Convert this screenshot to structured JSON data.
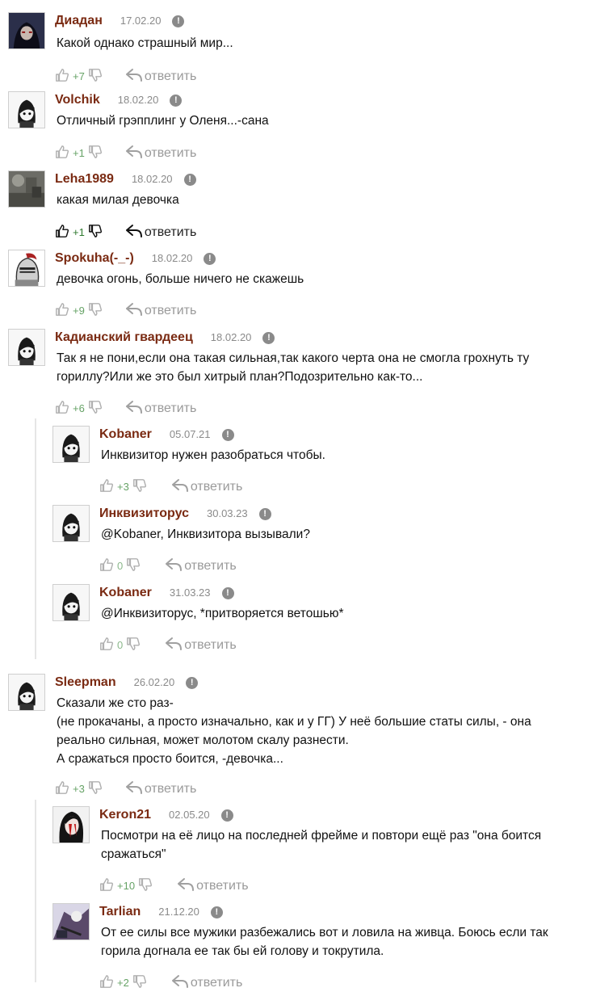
{
  "reply_label": "ответить",
  "comments": [
    {
      "author": "Диадан",
      "date": "17.02.20",
      "text": [
        "Какой однако страшный мир..."
      ],
      "votes": "+7"
    },
    {
      "author": "Volchik",
      "date": "18.02.20",
      "text": [
        "Отличный грэпплинг у Оленя...-сана"
      ],
      "votes": "+1"
    },
    {
      "author": "Leha1989",
      "date": "18.02.20",
      "text": [
        "какая милая девочка"
      ],
      "votes": "+1"
    },
    {
      "author": "Spokuha(-_-)",
      "date": "18.02.20",
      "text": [
        "девочка огонь, больше ничего не скажешь"
      ],
      "votes": "+9"
    },
    {
      "author": "Кадианский гвардеец",
      "date": "18.02.20",
      "text": [
        "Так я не пони,если она такая сильная,так какого черта она не смогла грохнуть ту",
        "гориллу?Или же это был хитрый план?Подозрительно как-то..."
      ],
      "votes": "+6"
    },
    {
      "author": "Kobaner",
      "date": "05.07.21",
      "text": [
        "Инквизитор нужен разобраться чтобы."
      ],
      "votes": "+3"
    },
    {
      "author": "Инквизиторус",
      "date": "30.03.23",
      "text": [
        "@Kobaner, Инквизитора вызывали?"
      ],
      "votes": "0"
    },
    {
      "author": "Kobaner",
      "date": "31.03.23",
      "text": [
        "@Инквизиторус, *притворяется ветошью*"
      ],
      "votes": "0"
    },
    {
      "author": "Sleepman",
      "date": "26.02.20",
      "text": [
        "Сказали же сто раз-",
        "(не прокачаны, а просто изначально, как и у ГГ) У неё большие статы силы, - она",
        "реально сильная, может молотом скалу разнести.",
        "А сражаться просто боится, -девочка..."
      ],
      "votes": "+3"
    },
    {
      "author": "Keron21",
      "date": "02.05.20",
      "text": [
        "Посмотри на её лицо на последней фрейме и повтори ещё раз \"она боится",
        "сражаться\""
      ],
      "votes": "+10"
    },
    {
      "author": "Tarlian",
      "date": "21.12.20",
      "text": [
        "От ее силы все мужики разбежались вот и ловила на живца. Боюсь если так",
        "горила догнала ее так бы ей голову и токрутила."
      ],
      "votes": "+2"
    }
  ]
}
